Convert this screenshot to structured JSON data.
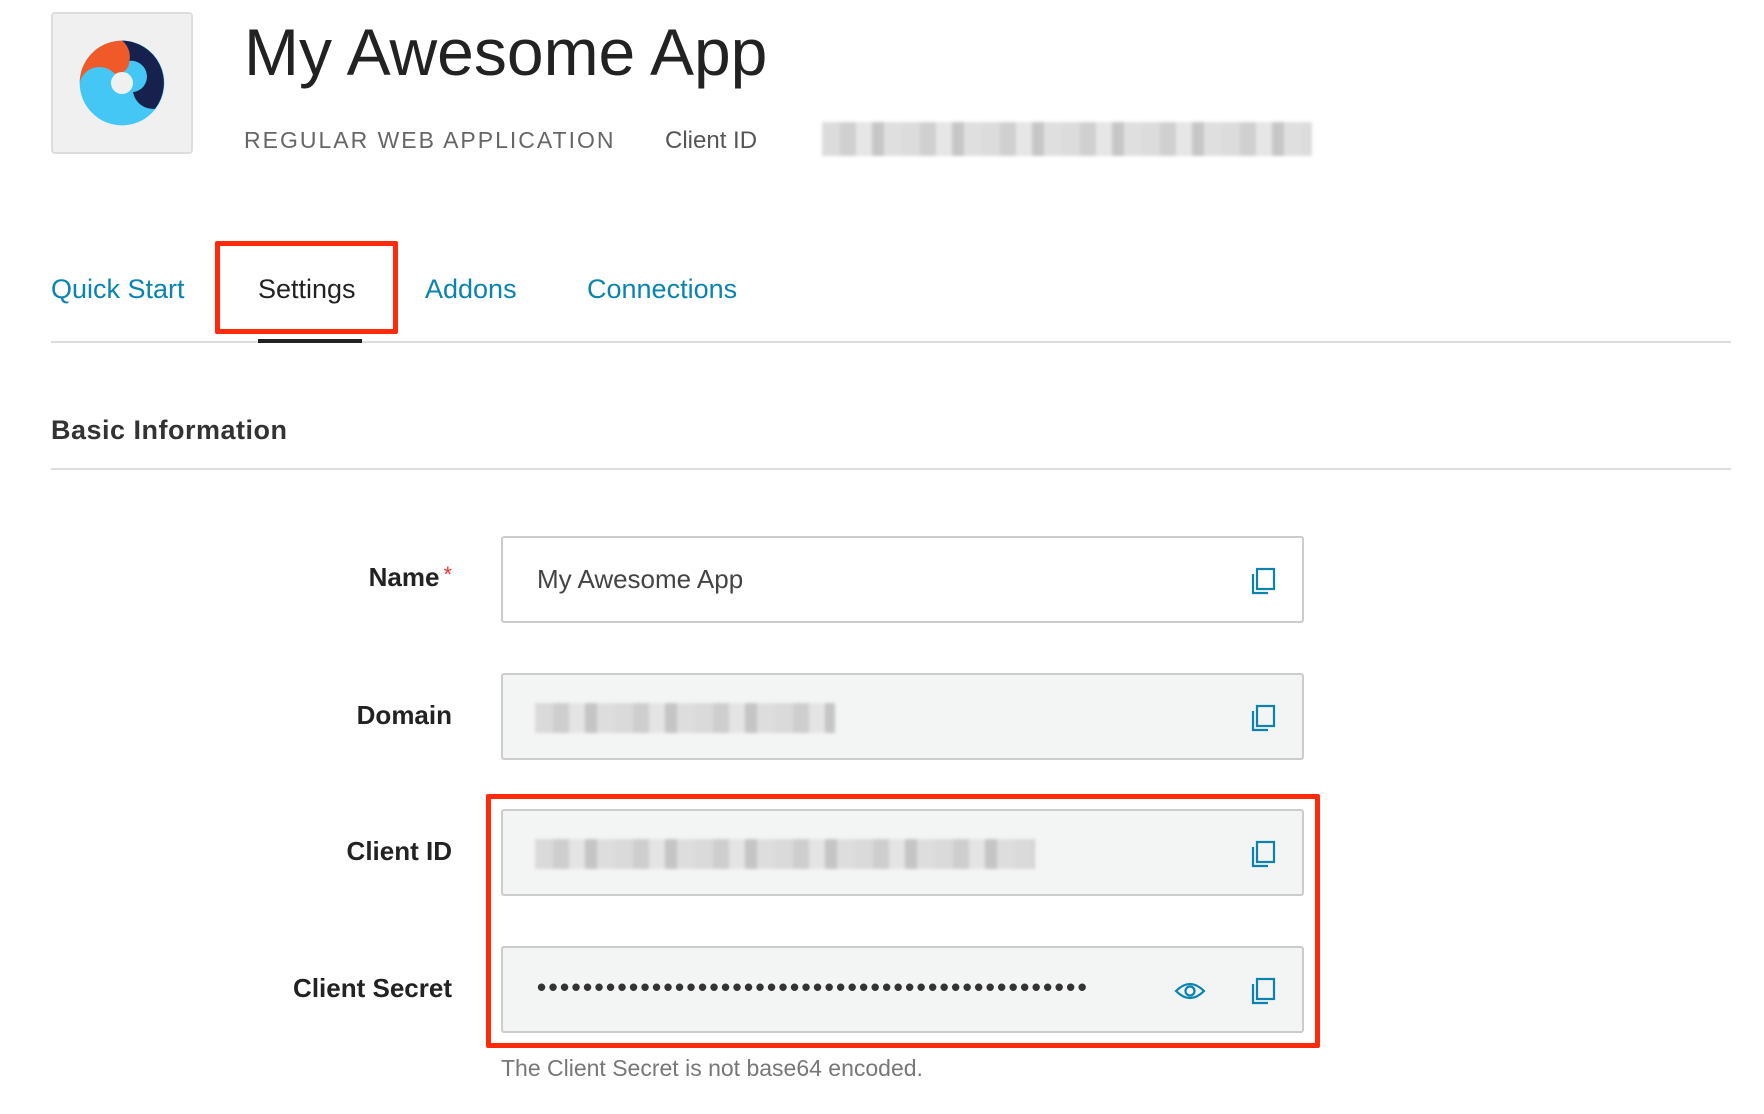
{
  "header": {
    "title": "My Awesome App",
    "app_type": "REGULAR WEB APPLICATION",
    "client_id_label": "Client ID",
    "logo_colors": {
      "orange": "#f05a28",
      "navy": "#16214d",
      "cyan": "#44c7f4"
    }
  },
  "tabs": [
    {
      "label": "Quick Start",
      "active": false
    },
    {
      "label": "Settings",
      "active": true
    },
    {
      "label": "Addons",
      "active": false
    },
    {
      "label": "Connections",
      "active": false
    }
  ],
  "section": {
    "title": "Basic Information"
  },
  "fields": {
    "name": {
      "label": "Name",
      "required_mark": "*",
      "value": "My Awesome App",
      "icon": "copy-icon"
    },
    "domain": {
      "label": "Domain",
      "icon": "copy-icon"
    },
    "client_id": {
      "label": "Client ID",
      "icon": "copy-icon"
    },
    "client_secret": {
      "label": "Client Secret",
      "value": "••••••••••••••••••••••••••••••••••••••••••••••••",
      "icons": [
        "eye-icon",
        "copy-icon"
      ],
      "helper": "The Client Secret is not base64 encoded."
    }
  },
  "colors": {
    "accent": "#0a84ae",
    "highlight": "#ff2a0a"
  }
}
